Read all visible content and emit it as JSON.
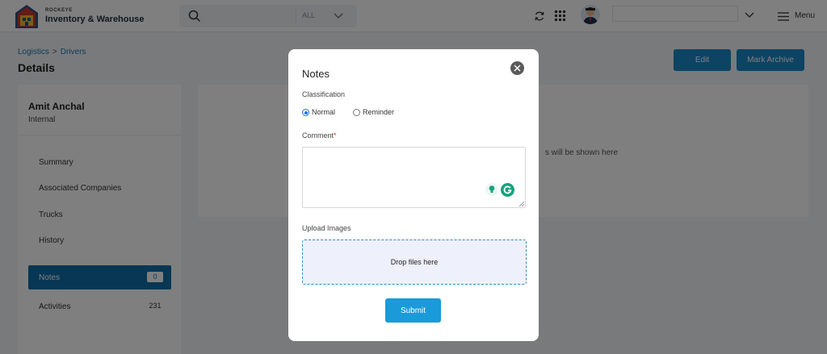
{
  "header": {
    "brand_small": "ROCKEYE",
    "brand_main": "Inventory & Warehouse",
    "search_placeholder": "",
    "filter_value": "ALL",
    "menu_label": "Menu",
    "icons": [
      "logo-icon",
      "search-icon",
      "chevron-down-icon",
      "refresh-icon",
      "apps-grid-icon",
      "avatar",
      "chevron-down-icon",
      "menu-icon"
    ]
  },
  "breadcrumb": {
    "items": [
      "Logistics",
      "Drivers"
    ],
    "separator": ">"
  },
  "page": {
    "title": "Details",
    "edit_label": "Edit",
    "archive_label": "Mark Archive"
  },
  "profile": {
    "name": "Amit Anchal",
    "type": "Internal"
  },
  "nav": {
    "items": [
      {
        "label": "Summary",
        "badge": ""
      },
      {
        "label": "Associated Companies",
        "badge": ""
      },
      {
        "label": "Trucks",
        "badge": ""
      },
      {
        "label": "History",
        "badge": ""
      },
      {
        "label": "Notes",
        "badge": "0"
      },
      {
        "label": "Activities",
        "badge": "231"
      }
    ],
    "active": "Notes"
  },
  "content": {
    "empty_text": "s will be shown here"
  },
  "modal": {
    "title": "Notes",
    "classification_label": "Classification",
    "options": [
      "Normal",
      "Reminder"
    ],
    "selected_option": "Normal",
    "comment_label": "Comment",
    "comment_required_mark": "*",
    "comment_value": "",
    "upload_label": "Upload Images",
    "dropzone_text": "Drop files here",
    "submit_label": "Submit"
  },
  "colors": {
    "primary": "#1a86c7",
    "active_nav": "#0e6fa8",
    "submit": "#1a9ad8",
    "dropzone_border": "#2d8fd0",
    "required": "#d0352b"
  }
}
